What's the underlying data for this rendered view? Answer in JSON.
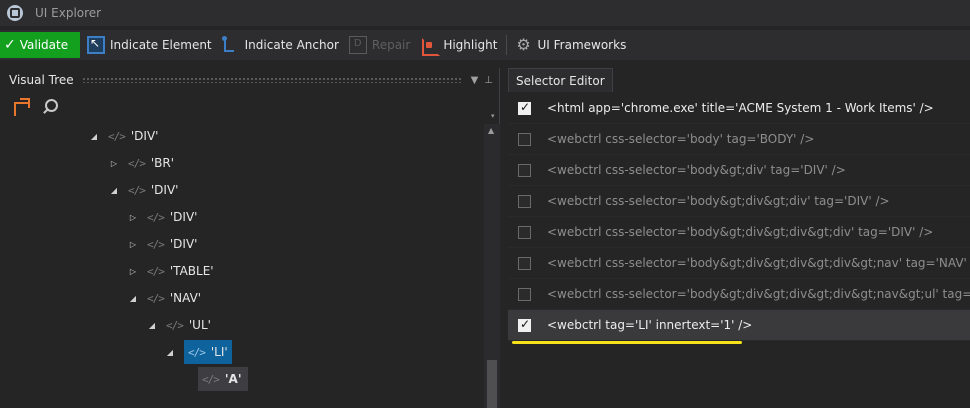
{
  "window": {
    "title": "UI Explorer",
    "app_icon": "ui-explorer-logo-icon"
  },
  "toolbar": {
    "validate_label": "Validate",
    "indicate_element_label": "Indicate Element",
    "indicate_anchor_label": "Indicate Anchor",
    "repair_label": "Repair",
    "highlight_label": "Highlight",
    "ui_frameworks_label": "UI Frameworks"
  },
  "visual_tree": {
    "title": "Visual Tree",
    "nodes": [
      {
        "label": "'DIV'",
        "expanded": true
      },
      {
        "label": "'BR'",
        "expanded": false
      },
      {
        "label": "'DIV'",
        "expanded": true
      },
      {
        "label": "'DIV'",
        "expanded": false
      },
      {
        "label": "'DIV'",
        "expanded": false
      },
      {
        "label": "'TABLE'",
        "expanded": false
      },
      {
        "label": "'NAV'",
        "expanded": true
      },
      {
        "label": "'UL'",
        "expanded": true
      },
      {
        "label": "'LI'",
        "expanded": true,
        "selected": true
      },
      {
        "label": "'A'",
        "hovered": true
      }
    ]
  },
  "selector_editor": {
    "tab_label": "Selector Editor",
    "rows": [
      {
        "text": "<html app='chrome.exe' title='ACME System 1 - Work Items' />",
        "checked": true
      },
      {
        "text": "<webctrl css-selector='body' tag='BODY' />",
        "checked": false
      },
      {
        "text": "<webctrl css-selector='body&gt;div' tag='DIV' />",
        "checked": false
      },
      {
        "text": "<webctrl css-selector='body&gt;div&gt;div' tag='DIV' />",
        "checked": false
      },
      {
        "text": "<webctrl css-selector='body&gt;div&gt;div&gt;div' tag='DIV' />",
        "checked": false
      },
      {
        "text": "<webctrl css-selector='body&gt;div&gt;div&gt;div&gt;nav' tag='NAV' />",
        "checked": false
      },
      {
        "text": "<webctrl css-selector='body&gt;div&gt;div&gt;div&gt;nav&gt;ul' tag='UL' />",
        "checked": false
      },
      {
        "text": "<webctrl tag='LI' innertext='1' />",
        "checked": true,
        "active": true
      }
    ]
  },
  "colors": {
    "validate_bg": "#14a01f",
    "selected_node_bg": "#0e639c",
    "annotation_underline": "#f6e21a"
  }
}
